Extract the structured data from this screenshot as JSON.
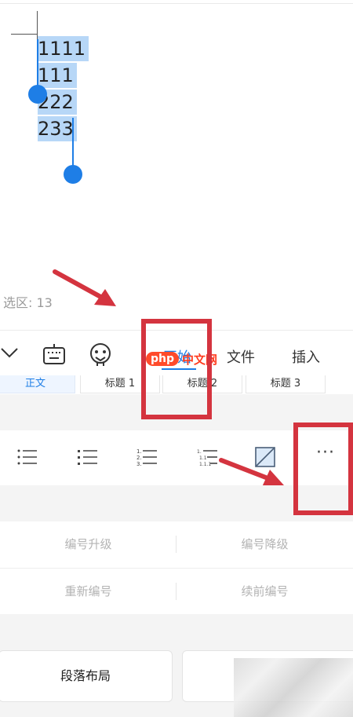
{
  "document": {
    "lines": [
      "1111",
      "111",
      "222",
      "233"
    ]
  },
  "status": {
    "selection": "选区: 13"
  },
  "toolbar": {
    "tabs": [
      {
        "label": "开始",
        "active": true
      },
      {
        "label": "文件",
        "active": false
      },
      {
        "label": "插入",
        "active": false
      }
    ],
    "icons": [
      "chevron-down-icon",
      "keyboard-icon",
      "voice-assistant-icon"
    ]
  },
  "styles": {
    "items": [
      {
        "label": "正文",
        "active": true
      },
      {
        "label": "标题 1",
        "active": false
      },
      {
        "label": "标题 2",
        "active": false
      },
      {
        "label": "标题 3",
        "active": false
      }
    ]
  },
  "list_toolbar": {
    "buttons": [
      "bullet-list-icon",
      "bullet-list-icon",
      "numbered-list-icon",
      "multilevel-list-icon",
      "clear-format-icon"
    ],
    "more_label": "···"
  },
  "numbering": {
    "promote": "编号升级",
    "demote": "编号降级",
    "restart": "重新编号",
    "continue": "续前编号"
  },
  "paragraph": {
    "layout_label": "段落布局"
  },
  "watermark": {
    "php": "php",
    "site": "中文网"
  },
  "colors": {
    "accent": "#1e7ee6",
    "selection": "#b7d7f7",
    "annotation": "#d4343f"
  }
}
